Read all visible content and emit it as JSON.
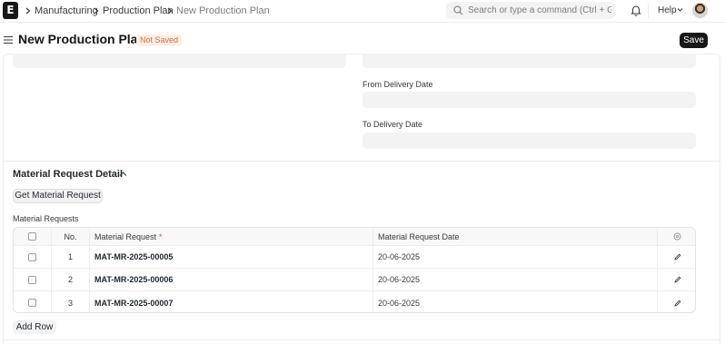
{
  "app": {
    "logo_letter": "E"
  },
  "breadcrumbs": [
    {
      "label": "Manufacturing"
    },
    {
      "label": "Production Plan"
    },
    {
      "label": "New Production Plan"
    }
  ],
  "search": {
    "placeholder": "Search or type a command (Ctrl + G)"
  },
  "navbar": {
    "help_label": "Help"
  },
  "page": {
    "title": "New Production Plan",
    "status_badge": "Not Saved",
    "save_label": "Save"
  },
  "form": {
    "from_delivery_date_label": "From Delivery Date",
    "from_delivery_date_value": "",
    "to_delivery_date_label": "To Delivery Date",
    "to_delivery_date_value": ""
  },
  "material_request_section": {
    "title": "Material Request Detail",
    "get_button_label": "Get Material Request",
    "table_label": "Material Requests",
    "columns": {
      "no": "No.",
      "material_request": "Material Request",
      "required_mark": "*",
      "material_request_date": "Material Request Date"
    },
    "rows": [
      {
        "no": "1",
        "material_request": "MAT-MR-2025-00005",
        "material_request_date": "20-06-2025"
      },
      {
        "no": "2",
        "material_request": "MAT-MR-2025-00006",
        "material_request_date": "20-06-2025"
      },
      {
        "no": "3",
        "material_request": "MAT-MR-2025-00007",
        "material_request_date": "20-06-2025"
      }
    ],
    "add_row_label": "Add Row"
  },
  "colors": {
    "primary_button": "#171717",
    "badge_text": "#d96c2a",
    "badge_bg": "#fdf0e7",
    "field_bg": "#f3f3f3"
  }
}
